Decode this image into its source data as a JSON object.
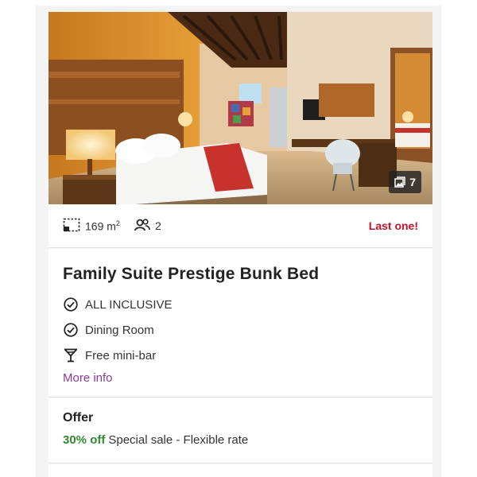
{
  "gallery": {
    "photo_count": "7",
    "photo_alt": "Hotel suite with bed, desk and chair",
    "icon": "image-icon"
  },
  "stats": {
    "area_value": "169 m",
    "area_unit_sup": "2",
    "area_icon": "room-size-icon",
    "guests": "2",
    "guests_icon": "people-icon",
    "availability": "Last one!",
    "availability_color": "#c4122f"
  },
  "room": {
    "title": "Family Suite Prestige Bunk Bed",
    "features": [
      {
        "label": "ALL INCLUSIVE",
        "icon": "check-circle-icon"
      },
      {
        "label": "Dining Room",
        "icon": "check-circle-icon"
      },
      {
        "label": "Free mini-bar",
        "icon": "cocktail-glass-icon"
      }
    ],
    "more_info": "More info",
    "link_color": "#8e3a9c"
  },
  "offer": {
    "heading": "Offer",
    "discount": "30% off",
    "description": "Special sale - Flexible rate",
    "discount_color": "#2e8b2e"
  }
}
